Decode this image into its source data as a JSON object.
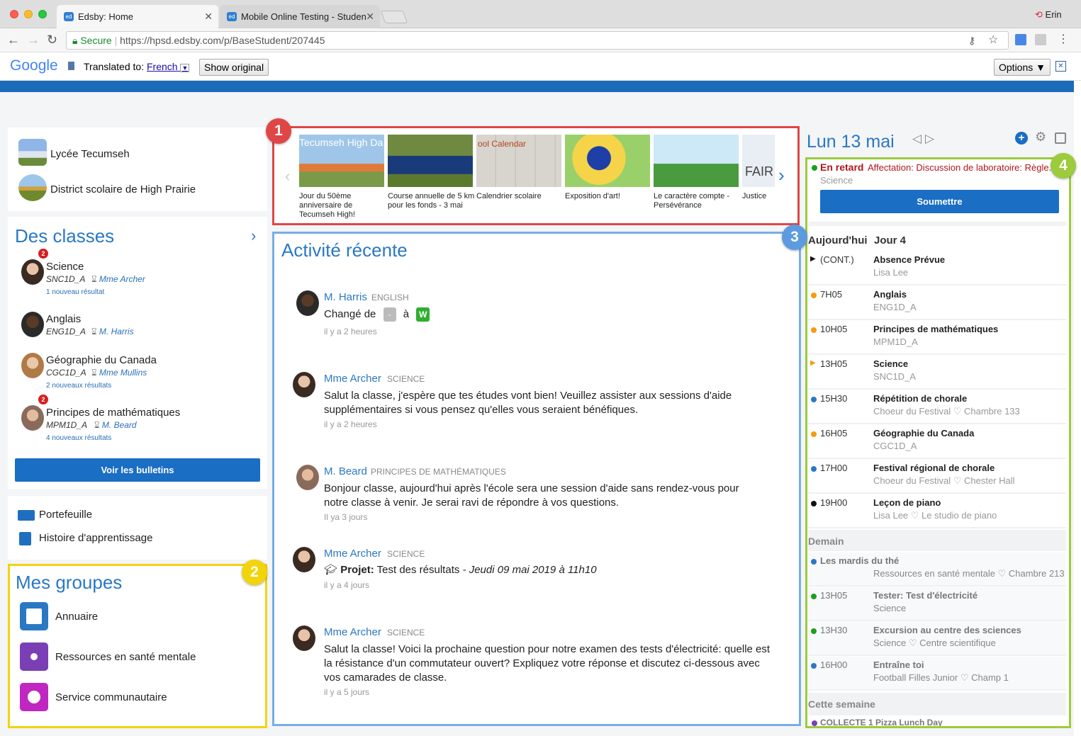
{
  "browser": {
    "tabs": [
      {
        "label": "Edsby: Home",
        "fav": "ed"
      },
      {
        "label": "Mobile Online Testing - Studen",
        "fav": "ed"
      }
    ],
    "profile_name": "Erin",
    "url_secure": "Secure",
    "url": "https://hpsd.edsby.com/p/BaseStudent/207445",
    "translate": {
      "logo": "Google",
      "translated_to": "Translated to:",
      "language": "French",
      "show_original": "Show original",
      "options": "Options ▼"
    }
  },
  "schools": [
    {
      "name": "Lycée Tecumseh"
    },
    {
      "name": "District scolaire de High Prairie"
    }
  ],
  "classes": {
    "title": "Des classes",
    "items": [
      {
        "name": "Science",
        "code": "SNC1D_A",
        "teacher": "Mme Archer",
        "note": "1 nouveau résultat",
        "badge": "2"
      },
      {
        "name": "Anglais",
        "code": "ENG1D_A",
        "teacher": "M. Harris",
        "note": "",
        "badge": ""
      },
      {
        "name": "Géographie du Canada",
        "code": "CGC1D_A",
        "teacher": "Mme Mullins",
        "note": "2 nouveaux résultats",
        "badge": ""
      },
      {
        "name": "Principes de mathématiques",
        "code": "MPM1D_A",
        "teacher": "M. Beard",
        "note": "4 nouveaux résultats",
        "badge": "2"
      }
    ],
    "report_button": "Voir les bulletins"
  },
  "links": [
    {
      "label": "Portefeuille",
      "icon": "folder-icon"
    },
    {
      "label": "Histoire d'apprentissage",
      "icon": "book-icon"
    }
  ],
  "groups": {
    "title": "Mes groupes",
    "items": [
      {
        "label": "Annuaire",
        "color": "#2a78c4"
      },
      {
        "label": "Ressources en santé mentale",
        "color": "#7b3fb5"
      },
      {
        "label": "Service communautaire",
        "color": "#c026c0"
      }
    ]
  },
  "callouts": [
    "1",
    "2",
    "3",
    "4"
  ],
  "carousel": {
    "items": [
      {
        "caption": "Jour du 50ème anniversaire de Tecumseh High!",
        "overlay": "Tecumseh High Da"
      },
      {
        "caption": "Course annuelle de 5 km pour les fonds - 3 mai",
        "overlay": ""
      },
      {
        "caption": "Calendrier scolaire",
        "overlay": "ool Calendar"
      },
      {
        "caption": "Exposition d'art!",
        "overlay": ""
      },
      {
        "caption": "Le caractère compte - Persévérance",
        "overlay": ""
      },
      {
        "caption": "Justice",
        "overlay": "FAIR"
      }
    ]
  },
  "activity": {
    "title": "Activité récente",
    "posts": [
      {
        "author": "M. Harris",
        "class": "ENGLISH",
        "text_prefix": "Changé de",
        "from": "-",
        "to_word": "à",
        "to": "W",
        "time": "il y a 2 heures"
      },
      {
        "author": "Mme Archer",
        "class": "SCIENCE",
        "text": "Salut la classe, j'espère que tes études vont bien! Veuillez assister aux sessions d'aide supplémentaires si vous pensez qu'elles vous seraient bénéfiques.",
        "time": "il y a 2 heures"
      },
      {
        "author": "M. Beard",
        "class": "PRINCIPES DE MATHÉMATIQUES",
        "text": "Bonjour classe, aujourd'hui après l'école sera une session d'aide sans rendez-vous pour notre classe à venir. Je serai ravi de répondre à vos questions.",
        "time": "Il ya 3 jours"
      },
      {
        "author": "Mme Archer",
        "class": "SCIENCE",
        "project_label": "Projet:",
        "project_text": "Test des résultats",
        "project_date": "- Jeudi 09 mai 2019 à 11h10",
        "time": "il y a 4 jours"
      },
      {
        "author": "Mme Archer",
        "class": "SCIENCE",
        "text": "Salut la classe! Voici la prochaine question pour notre examen des tests d'électricité: quelle est la résistance d'un commutateur ouvert? Expliquez votre réponse et discutez ci-dessous avec vos camarades de classe.",
        "time": "il y a 5 jours"
      }
    ]
  },
  "agenda": {
    "date": "Lun 13 mai",
    "late_label": "En retard",
    "late_text": "Affectation: Discussion de laboratoire: Règle...",
    "late_class": "Science",
    "submit": "Soumettre",
    "today_label": "Aujourd'hui",
    "day_label": "Jour 4",
    "today": [
      {
        "time": "(CONT.)",
        "title": "Absence Prévue",
        "sub": "Lisa Lee",
        "color": "#111",
        "marker": "triangle"
      },
      {
        "time": "7H05",
        "title": "Anglais",
        "sub": "ENG1D_A",
        "color": "#f39c12",
        "marker": "dot"
      },
      {
        "time": "10H05",
        "title": "Principes de mathématiques",
        "sub": "MPM1D_A",
        "color": "#f39c12",
        "marker": "dot"
      },
      {
        "time": "13H05",
        "title": "Science",
        "sub": "SNC1D_A",
        "color": "#f39c12",
        "marker": "triangle"
      },
      {
        "time": "15H30",
        "title": "Répétition de chorale",
        "sub": "Choeur du Festival ♡ Chambre 133",
        "color": "#2a78c4",
        "marker": "dot"
      },
      {
        "time": "16H05",
        "title": "Géographie du Canada",
        "sub": "CGC1D_A",
        "color": "#f39c12",
        "marker": "dot"
      },
      {
        "time": "17H00",
        "title": "Festival régional de chorale",
        "sub": "Choeur du Festival ♡ Chester Hall",
        "color": "#2a78c4",
        "marker": "dot"
      },
      {
        "time": "19H00",
        "title": "Leçon de piano",
        "sub": "Lisa Lee ♡ Le studio de piano",
        "color": "#111",
        "marker": "dot"
      }
    ],
    "tomorrow_label": "Demain",
    "tomorrow": [
      {
        "time": "",
        "title": "Les mardis du thé",
        "sub": "Ressources en santé mentale ♡ Chambre 213",
        "color": "#2a78c4"
      },
      {
        "time": "13H05",
        "title": "Tester: Test d'électricité",
        "sub": "Science",
        "color": "#1aa01a"
      },
      {
        "time": "13H30",
        "title": "Excursion au centre des sciences",
        "sub": "Science ♡ Centre scientifique",
        "color": "#1aa01a"
      },
      {
        "time": "16H00",
        "title": "Entraîne toi",
        "sub": "Football Filles Junior ♡ Champ 1",
        "color": "#2a78c4"
      }
    ],
    "week_label": "Cette semaine",
    "week_first": "COLLECTE 1 Pizza Lunch Day"
  }
}
